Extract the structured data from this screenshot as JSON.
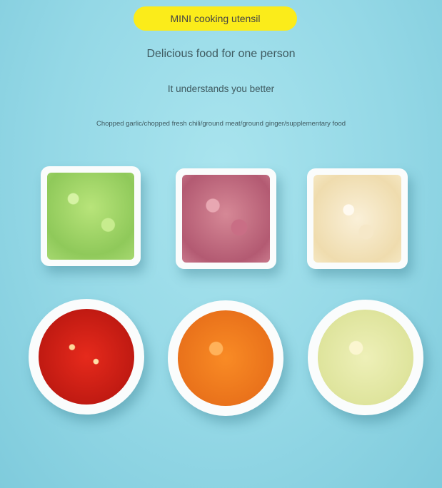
{
  "banner": {
    "label": "MINI cooking utensil"
  },
  "headline": "Delicious food for one person",
  "subheadline": "It understands you better",
  "caption": "Chopped garlic/chopped fresh chili/ground meat/ground ginger/supplementary food",
  "colors": {
    "banner": "#fbec1a",
    "background": "#94d8e6",
    "text": "#3f5a60"
  }
}
